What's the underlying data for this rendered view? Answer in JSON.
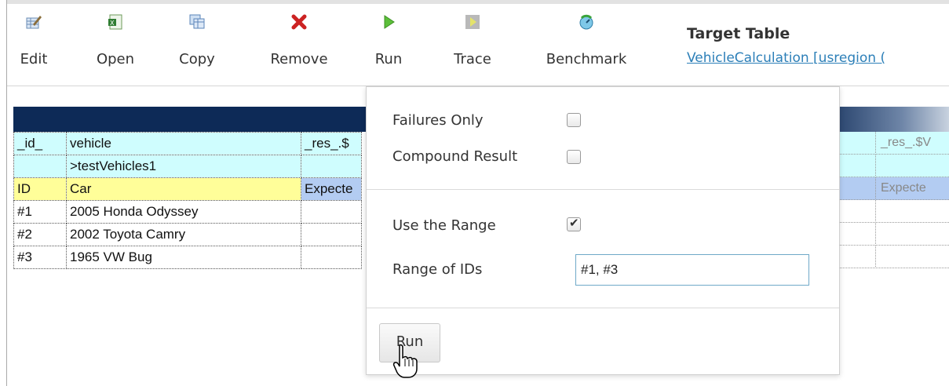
{
  "toolbar": {
    "items": [
      {
        "label": "Edit",
        "icon": "edit-icon"
      },
      {
        "label": "Open",
        "icon": "excel-icon"
      },
      {
        "label": "Copy",
        "icon": "copy-table-icon"
      },
      {
        "label": "Remove",
        "icon": "remove-icon"
      },
      {
        "label": "Run",
        "icon": "play-icon"
      },
      {
        "label": "Trace",
        "icon": "trace-icon"
      },
      {
        "label": "Benchmark",
        "icon": "benchmark-icon"
      }
    ],
    "target_title": "Target Table",
    "target_link": "VehicleCalculation [usregion ("
  },
  "table": {
    "header_row": [
      "_id_",
      "vehicle",
      "_res_.$"
    ],
    "param_row": [
      "",
      ">testVehicles1",
      ""
    ],
    "display_row": [
      "ID",
      "Car",
      "Expecte"
    ],
    "rows": [
      [
        "#1",
        "2005 Honda Odyssey",
        ""
      ],
      [
        "#2",
        "2002 Toyota Camry",
        ""
      ],
      [
        "#3",
        "1965 VW Bug",
        ""
      ]
    ],
    "right_header": "_res_.$V",
    "right_display": "Expecte"
  },
  "popup": {
    "failures_only": {
      "label": "Failures Only",
      "checked": false
    },
    "compound_result": {
      "label": "Compound Result",
      "checked": false
    },
    "use_range": {
      "label": "Use the Range",
      "checked": true
    },
    "range_ids": {
      "label": "Range of IDs",
      "value": "#1, #3"
    },
    "run_label": "Run"
  },
  "colors": {
    "header_dark": "#0d2a57",
    "cyan_row": "#cffdfe",
    "yellow_cell": "#fffe99",
    "blue_cell": "#b3ccf2",
    "link": "#2c7fb8"
  }
}
